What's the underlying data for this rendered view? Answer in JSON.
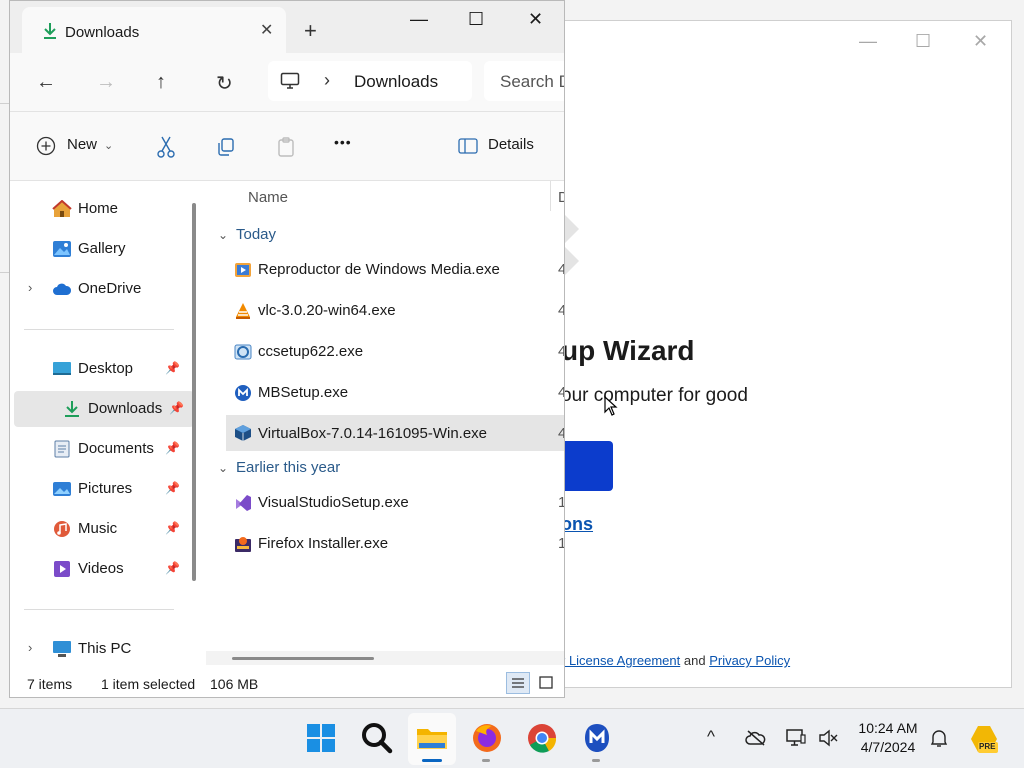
{
  "explorer": {
    "tab_title": "Downloads",
    "tab_close": "✕",
    "new_tab": "+",
    "window_controls": {
      "minimize": "—",
      "maximize": "☐",
      "close": "✕"
    },
    "nav": {
      "back": "←",
      "forward": "→",
      "up": "↑",
      "refresh": "↻",
      "chevron": "›"
    },
    "breadcrumb": "Downloads",
    "search_placeholder": "Search D",
    "toolbar": {
      "new_label": "New",
      "new_caret": "⌄",
      "more": "•••",
      "details_label": "Details"
    },
    "sidebar": [
      {
        "label": "Home",
        "icon": "home-icon"
      },
      {
        "label": "Gallery",
        "icon": "gallery-icon"
      },
      {
        "label": "OneDrive",
        "icon": "cloud-icon",
        "expandable": true
      },
      {
        "label": "Desktop",
        "icon": "desktop-icon",
        "pinned": true
      },
      {
        "label": "Downloads",
        "icon": "download-icon",
        "pinned": true,
        "selected": true
      },
      {
        "label": "Documents",
        "icon": "document-icon",
        "pinned": true
      },
      {
        "label": "Pictures",
        "icon": "picture-icon",
        "pinned": true
      },
      {
        "label": "Music",
        "icon": "music-icon",
        "pinned": true
      },
      {
        "label": "Videos",
        "icon": "video-icon",
        "pinned": true
      },
      {
        "label": "This PC",
        "icon": "computer-icon",
        "expandable": true
      }
    ],
    "pin_glyph": "📌",
    "expand_glyph": "›",
    "column_name": "Name",
    "column_date_partial": "D",
    "groups": [
      {
        "label": "Today",
        "files": [
          {
            "name": "Reproductor de Windows Media.exe",
            "date_partial": "4"
          },
          {
            "name": "vlc-3.0.20-win64.exe",
            "date_partial": "4"
          },
          {
            "name": "ccsetup622.exe",
            "date_partial": "4"
          },
          {
            "name": "MBSetup.exe",
            "date_partial": "4"
          },
          {
            "name": "VirtualBox-7.0.14-161095-Win.exe",
            "date_partial": "4",
            "selected": true
          }
        ]
      },
      {
        "label": "Earlier this year",
        "files": [
          {
            "name": "VisualStudioSetup.exe",
            "date_partial": "1"
          },
          {
            "name": "Firefox Installer.exe",
            "date_partial": "1"
          }
        ]
      }
    ],
    "group_chevron": "⌄",
    "status": {
      "items": "7 items",
      "selected": "1 item selected",
      "size": "106 MB"
    }
  },
  "installer": {
    "title_partial": "up Wizard",
    "subtitle_partial": "our computer for good",
    "link_partial": "ons",
    "legal_link1": "r License Agreement",
    "legal_and": "and",
    "legal_link2": "Privacy Policy",
    "controls": {
      "minimize": "—",
      "maximize": "☐",
      "close": "✕"
    }
  },
  "taskbar": {
    "clock_time": "10:24 AM",
    "clock_date": "4/7/2024",
    "tray_chevron": "^",
    "badge_label": "PRE",
    "apps": [
      "start-icon",
      "search-icon",
      "file-explorer-icon",
      "firefox-icon",
      "chrome-icon",
      "malwarebytes-icon"
    ]
  }
}
